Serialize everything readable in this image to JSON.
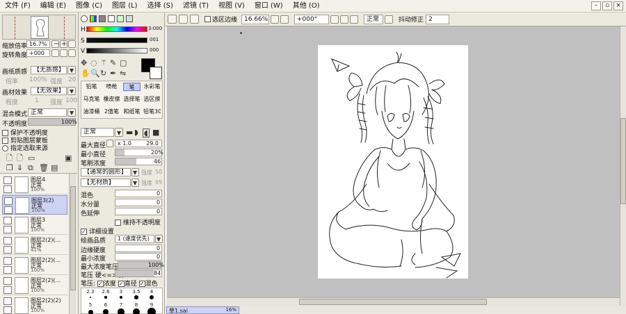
{
  "menubar": {
    "items": [
      "文件 (F)",
      "编辑 (E)",
      "图像 (C)",
      "图层 (L)",
      "选择 (S)",
      "滤镜 (T)",
      "视图 (V)",
      "窗口 (W)",
      "其他 (O)"
    ],
    "minimize": "–",
    "restore": "▫",
    "close": "×"
  },
  "navigator": {
    "zoom_label": "缩放倍率",
    "zoom_value": "16.7%",
    "rotate_label": "旋转角度",
    "rotate_value": "+000"
  },
  "paper": {
    "texture_label": "画纸质感",
    "texture_value": "【无质感】",
    "texture_sub1": "倍率",
    "texture_sub1_value": "100%",
    "texture_sub2": "强度",
    "texture_sub2_value": "20",
    "effect_label": "画材效果",
    "effect_value": "【无效果】",
    "effect_sub1": "程度",
    "effect_sub1_value": "1",
    "effect_sub2": "强度",
    "effect_sub2_value": "100"
  },
  "layer_props": {
    "blend_label": "混合模式",
    "blend_value": "正常",
    "opacity_label": "不透明度",
    "opacity_value": "100%",
    "opacity_fraction": 1.0,
    "checks": [
      "保护不透明度",
      "剪贴图层蒙板",
      "指定选取来源"
    ]
  },
  "layers": [
    {
      "name": "图层4",
      "mode": "正常",
      "opacity": "100%",
      "selected": false
    },
    {
      "name": "图层3(2)",
      "mode": "正常",
      "opacity": "100%",
      "selected": true
    },
    {
      "name": "图层3",
      "mode": "正常",
      "opacity": "100%",
      "selected": false
    },
    {
      "name": "图层2(2)(...",
      "mode": "正常",
      "opacity": "41%",
      "selected": false
    },
    {
      "name": "图层2(2)(...",
      "mode": "正常",
      "opacity": "100%",
      "selected": false
    },
    {
      "name": "图层2(2)(...",
      "mode": "正常",
      "opacity": "100%",
      "selected": false
    },
    {
      "name": "图层2(2)(2)",
      "mode": "正常",
      "opacity": "100%",
      "selected": false
    }
  ],
  "color": {
    "h_label": "H",
    "h_value": "3:000",
    "s_label": "S",
    "s_value": "001",
    "v_label": "V",
    "v_value": "000",
    "foreground": "#000000",
    "background": "#ffffff"
  },
  "tools": {
    "row1": [
      "铅笔",
      "喷枪",
      "笔",
      "水彩笔"
    ],
    "row2": [
      "马克笔",
      "橡皮擦",
      "选择笔",
      "选区擦"
    ],
    "row3": [
      "油漆桶",
      "2值笔",
      "和纸笔",
      "铅笔30"
    ],
    "selected": "笔"
  },
  "brush": {
    "mode_value": "正常",
    "max_size_label": "最大直径",
    "max_size_mult": "x 1.0",
    "max_size_value": "29.0",
    "min_size_label": "最小直径",
    "min_size_value": "20%",
    "min_size_fraction": 0.2,
    "density_label": "笔刷浓度",
    "density_value": "46",
    "density_fraction": 0.46,
    "shape_value": "【通常的圆形】",
    "shape_sub": "强度",
    "shape_sub_value": "50",
    "texture_value": "【无材质】",
    "texture_sub": "强度",
    "texture_sub_value": "95",
    "blend_label": "混色",
    "blend_value": "0",
    "water_label": "水分量",
    "water_value": "0",
    "persist_label": "色延伸",
    "persist_value": "0",
    "keep_opacity_label": "维持不透明度",
    "detail_label": "详细设置",
    "quality_label": "绘画品质",
    "quality_value": "1 (速度优先)",
    "edge_label": "边缘硬度",
    "edge_value": "0",
    "min_density_label": "最小浓度",
    "min_density_value": "0",
    "max_density_pressure_label": "最大浓度笔压",
    "max_density_pressure_value": "100%",
    "max_density_pressure_fraction": 1.0,
    "pressure_hardness_label": "笔压 硬<=>软",
    "pressure_hardness_value": "84",
    "pressure_hardness_fraction": 0.84,
    "pressure_label": "笔压:",
    "pressure_density": "浓度",
    "pressure_size": "直径",
    "pressure_blend": "混色",
    "size_presets_row1": [
      "2.3",
      "2.6",
      "3",
      "3.5",
      "4"
    ],
    "size_presets_row2": [
      "5",
      "6",
      "7",
      "8",
      "9"
    ]
  },
  "toolbar2": {
    "selection_edge_label": "选区边缘",
    "zoom_value": "16.66%",
    "angle_value": "+000°",
    "blend_value": "正常",
    "stabilizer_label": "抖动修正",
    "stabilizer_value": "2"
  },
  "statusbar": {
    "doc_name": "草1.sai",
    "doc_zoom": "16%"
  },
  "colors": {
    "panel": "#ece9df",
    "selected": "#cdd3f3",
    "canvas_bg": "#c0c0c0"
  }
}
